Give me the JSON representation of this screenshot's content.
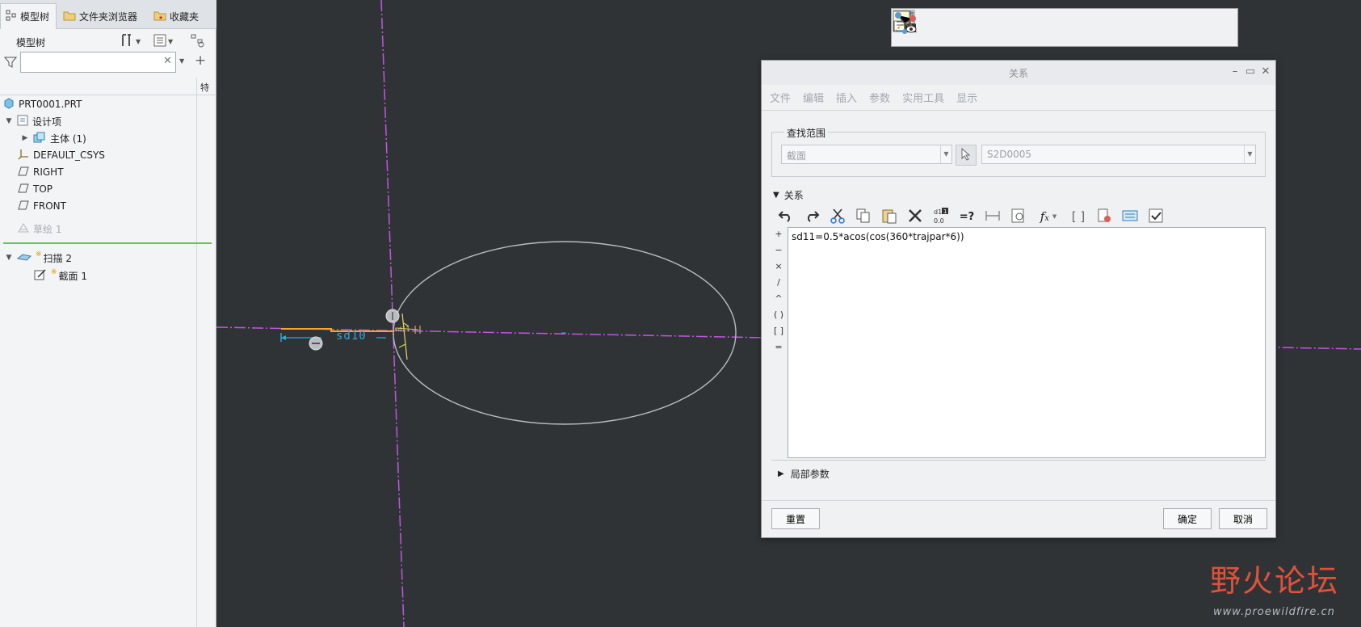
{
  "left_panel": {
    "tabs": [
      {
        "label": "模型树",
        "icon": "model-tree-icon"
      },
      {
        "label": "文件夹浏览器",
        "icon": "folder-icon"
      },
      {
        "label": "收藏夹",
        "icon": "favorites-icon"
      }
    ],
    "tree_title": "模型树",
    "filter_placeholder": "",
    "column_label": "特",
    "tree_items": [
      {
        "label": "PRT0001.PRT",
        "icon": "part-icon"
      },
      {
        "label": "设计项",
        "icon": "design-items-icon"
      },
      {
        "label": "主体 (1)",
        "icon": "body-icon"
      },
      {
        "label": "DEFAULT_CSYS",
        "icon": "csys-icon"
      },
      {
        "label": "RIGHT",
        "icon": "datum-plane-icon"
      },
      {
        "label": "TOP",
        "icon": "datum-plane-icon"
      },
      {
        "label": "FRONT",
        "icon": "datum-plane-icon"
      },
      {
        "label": "草绘 1",
        "icon": "sketch-icon",
        "state": "disabled"
      },
      {
        "label": "扫描 2",
        "icon": "sweep-icon"
      },
      {
        "label": "截面 1",
        "icon": "section-icon"
      }
    ]
  },
  "canvas": {
    "dimension_label": "sd10",
    "dimension_label_2": "sd11",
    "view_toolbar": [
      "refit-icon",
      "zoom-in-icon",
      "zoom-out-icon",
      "display-style-icon",
      "saved-views-icon",
      "view-orientation-icon",
      "perspective-view-icon",
      "datum-display-icon",
      "annotation-display-icon",
      "spin-center-icon"
    ],
    "watermark_text": "野火论坛",
    "watermark_url": "www.proewildfire.cn"
  },
  "dialog": {
    "title": "关系",
    "menus": [
      "文件",
      "编辑",
      "插入",
      "参数",
      "实用工具",
      "显示"
    ],
    "scope_label": "查找范围",
    "scope_type": "截面",
    "scope_name": "S2D0005",
    "relations_label": "关系",
    "operators": [
      "+",
      "−",
      "×",
      "/",
      "^",
      "( )",
      "[ ]",
      "="
    ],
    "relation_text": "sd11=0.5*acos(cos(360*trajpar*6))",
    "local_params_label": "局部参数",
    "reset_label": "重置",
    "ok_label": "确定",
    "cancel_label": "取消"
  },
  "colors": {
    "canvas_bg": "#2f3336",
    "axis": "#c056e0",
    "ellipse": "#b8bcc0",
    "sketch_line": "#f5a623",
    "dimension": "#2fa9d6",
    "watermark": "#e0513a"
  }
}
